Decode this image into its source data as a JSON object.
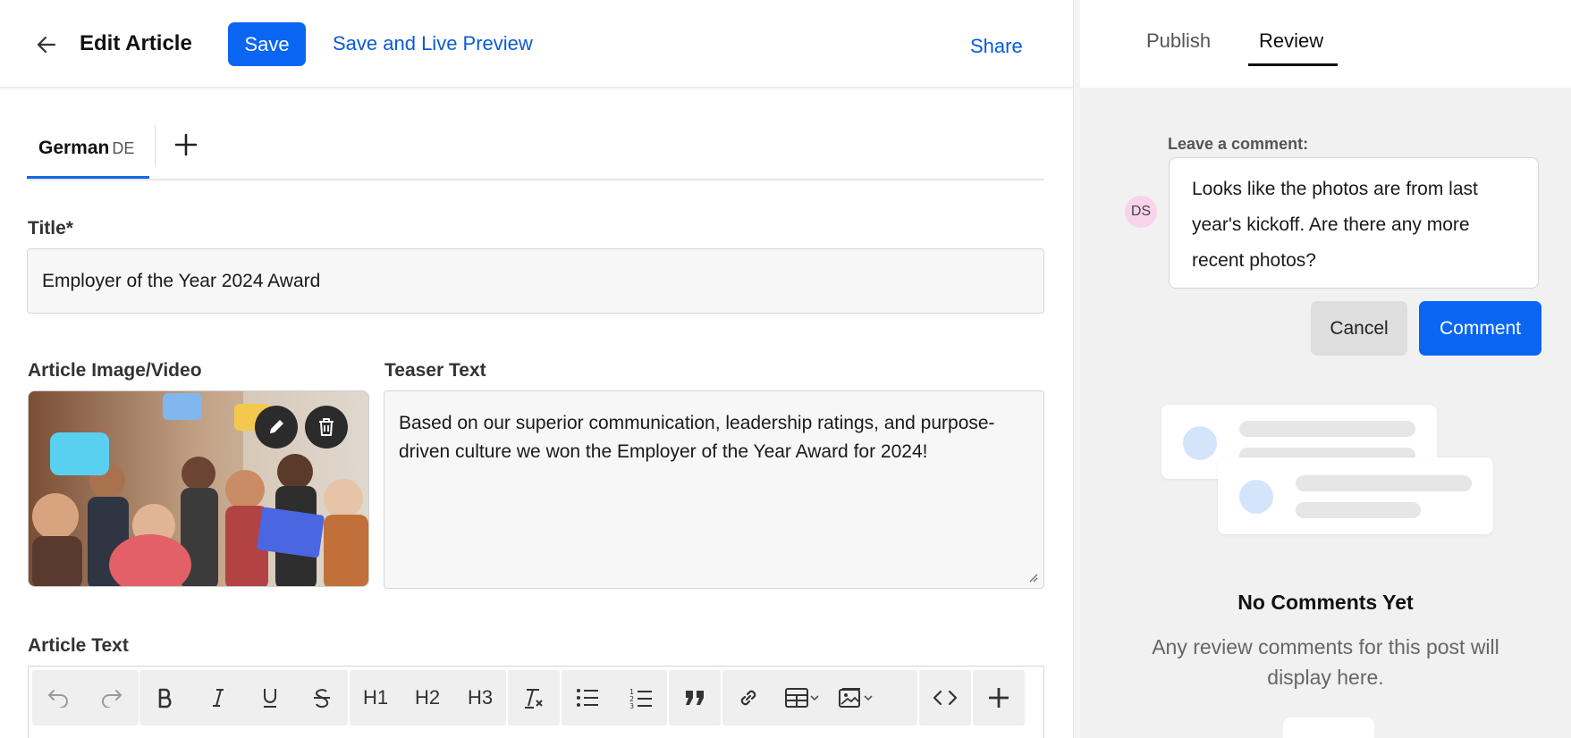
{
  "header": {
    "title": "Edit Article",
    "save_label": "Save",
    "live_preview_label": "Save and Live Preview",
    "share_label": "Share"
  },
  "language_tabs": [
    {
      "name": "German",
      "code": "DE"
    }
  ],
  "fields": {
    "title_label": "Title*",
    "title_value": "Employer of the Year 2024 Award",
    "media_label": "Article Image/Video",
    "teaser_label": "Teaser Text",
    "teaser_value": "Based on our superior communication, leadership ratings, and purpose-driven culture we won the Employer of the Year Award for 2024!",
    "article_text_label": "Article Text"
  },
  "toolbar": {
    "text_buttons": {
      "h1": "H1",
      "h2": "H2",
      "h3": "H3"
    },
    "icons": [
      "undo-icon",
      "redo-icon",
      "bold-icon",
      "italic-icon",
      "underline-icon",
      "strikethrough-icon",
      "clear-format-icon",
      "bullet-list-icon",
      "numbered-list-icon",
      "quote-icon",
      "link-icon",
      "table-icon",
      "image-icon",
      "code-icon",
      "plus-icon"
    ]
  },
  "review_panel": {
    "tabs": [
      "Publish",
      "Review"
    ],
    "active_tab": "Review",
    "comment_label": "Leave a comment:",
    "avatar_initials": "DS",
    "comment_text": "Looks like the photos are from last year's kickoff. Are there any more recent photos?",
    "cancel_label": "Cancel",
    "comment_button_label": "Comment",
    "empty_title": "No Comments Yet",
    "empty_description": "Any review comments for this post will display here."
  },
  "colors": {
    "accent": "#0a66f2",
    "link": "#0a5bd6",
    "avatar_bg": "#f8d3ec"
  }
}
